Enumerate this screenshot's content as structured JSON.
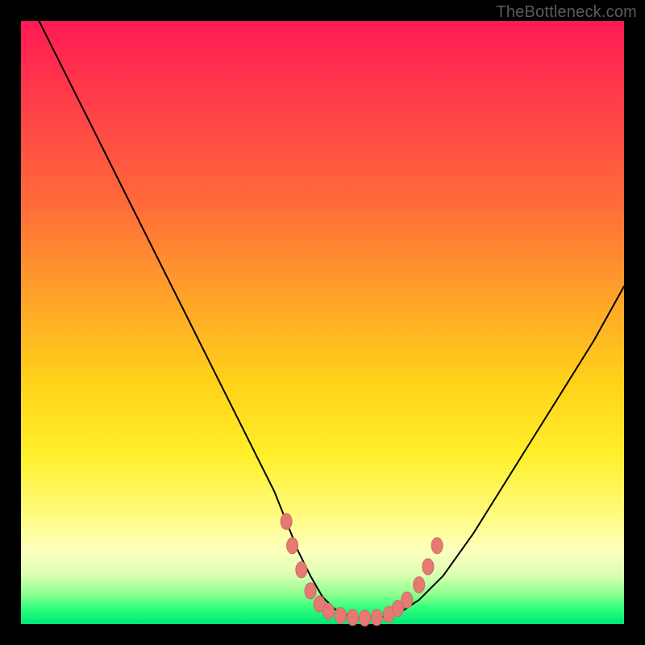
{
  "watermark": "TheBottleneck.com",
  "chart_data": {
    "type": "line",
    "title": "",
    "xlabel": "",
    "ylabel": "",
    "xlim": [
      0,
      100
    ],
    "ylim": [
      0,
      100
    ],
    "grid": false,
    "legend": null,
    "background_gradient_stops": [
      {
        "pos": 0,
        "color": "#ff1a54"
      },
      {
        "pos": 12,
        "color": "#ff3a4a"
      },
      {
        "pos": 30,
        "color": "#ff6a3a"
      },
      {
        "pos": 45,
        "color": "#ffa02a"
      },
      {
        "pos": 60,
        "color": "#ffd21a"
      },
      {
        "pos": 72,
        "color": "#ffef2a"
      },
      {
        "pos": 82,
        "color": "#fffb80"
      },
      {
        "pos": 88,
        "color": "#fdffbf"
      },
      {
        "pos": 92,
        "color": "#d8ffb0"
      },
      {
        "pos": 95,
        "color": "#8fff90"
      },
      {
        "pos": 97.5,
        "color": "#2cff7a"
      },
      {
        "pos": 100,
        "color": "#00e676"
      }
    ],
    "series": [
      {
        "name": "bottleneck-curve",
        "x": [
          3,
          6,
          9,
          12,
          15,
          18,
          21,
          24,
          27,
          30,
          33,
          36,
          39,
          42,
          44,
          46,
          48,
          50,
          52,
          54,
          56,
          58,
          60,
          63,
          66,
          70,
          75,
          80,
          85,
          90,
          95,
          100
        ],
        "y": [
          100,
          94,
          88,
          82,
          76,
          70,
          64,
          58,
          52,
          46,
          40,
          34,
          28,
          22,
          17,
          12,
          8,
          4.5,
          2.5,
          1.5,
          1,
          1,
          1.2,
          2,
          4,
          8,
          15,
          23,
          31,
          39,
          47,
          56
        ]
      }
    ],
    "markers": {
      "name": "trough-markers",
      "color": "#e47a72",
      "points": [
        {
          "x": 44.0,
          "y": 17.0
        },
        {
          "x": 45.0,
          "y": 13.0
        },
        {
          "x": 46.5,
          "y": 9.0
        },
        {
          "x": 48.0,
          "y": 5.5
        },
        {
          "x": 49.5,
          "y": 3.3
        },
        {
          "x": 51.0,
          "y": 2.1
        },
        {
          "x": 53.0,
          "y": 1.4
        },
        {
          "x": 55.0,
          "y": 1.1
        },
        {
          "x": 57.0,
          "y": 1.0
        },
        {
          "x": 59.0,
          "y": 1.1
        },
        {
          "x": 61.0,
          "y": 1.6
        },
        {
          "x": 62.5,
          "y": 2.6
        },
        {
          "x": 64.0,
          "y": 4.0
        },
        {
          "x": 66.0,
          "y": 6.5
        },
        {
          "x": 67.5,
          "y": 9.5
        },
        {
          "x": 69.0,
          "y": 13.0
        }
      ]
    }
  }
}
